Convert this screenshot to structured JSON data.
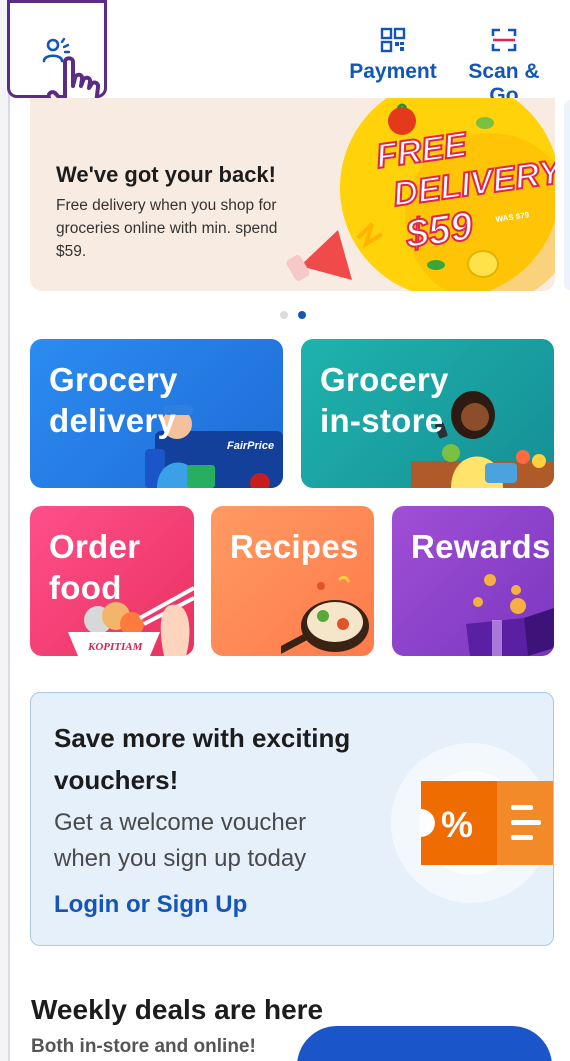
{
  "header": {
    "payment_label": "Payment",
    "scan_label": "Scan & Go",
    "account_icon": "person-icon"
  },
  "banner": {
    "title": "We've got your back!",
    "text": "Free delivery when you shop for groceries online with min. spend $59.",
    "promo_line1": "FREE",
    "promo_line2": "DELIVERY",
    "promo_price": "$59",
    "promo_was": "WAS $79",
    "page_count": 2,
    "active_page": 2
  },
  "tiles": [
    {
      "label_1": "Grocery",
      "label_2": "delivery",
      "brand": "FairPrice"
    },
    {
      "label_1": "Grocery",
      "label_2": "in-store"
    },
    {
      "label_1": "Order",
      "label_2": "food",
      "brand": "KOPITIAM"
    },
    {
      "label_1": "Recipes"
    },
    {
      "label_1": "Rewards"
    }
  ],
  "voucher": {
    "title": "Save more with exciting vouchers!",
    "text": "Get a welcome voucher when you sign up today",
    "link": "Login or Sign Up",
    "badge": "%"
  },
  "weekly": {
    "title": "Weekly deals are here",
    "subtitle": "Both in-store and online!"
  },
  "colors": {
    "brand_blue": "#1456b8",
    "grocery_delivery": "#2b8cf0",
    "grocery_instore": "#1fb3ad",
    "order_food": "#ff4f8b",
    "recipes": "#ff8a55",
    "rewards": "#8f42cc",
    "voucher_bg": "#e5f0fb",
    "highlight_border": "#5b2c83"
  }
}
